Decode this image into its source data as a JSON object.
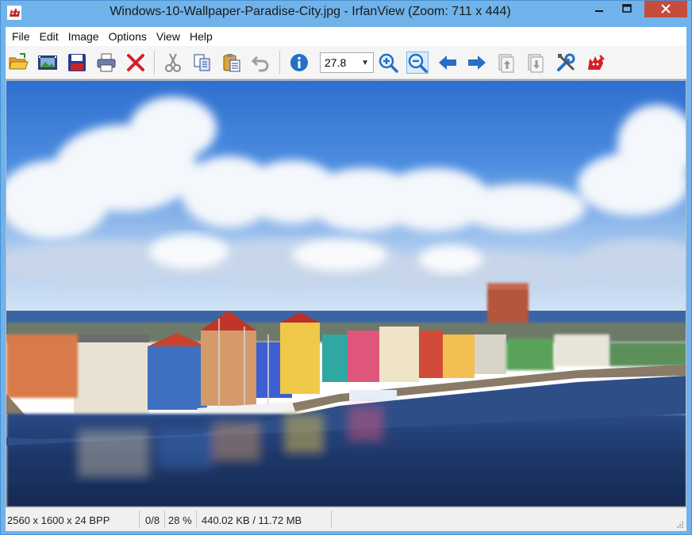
{
  "window": {
    "title": "Windows-10-Wallpaper-Paradise-City.jpg - IrfanView (Zoom: 711 x 444)",
    "app_icon": "irfanview-cat-icon",
    "controls": [
      "minimize-icon",
      "maximize-icon",
      "close-icon"
    ],
    "accent_color": "#6fb3ea",
    "close_color": "#c74c3c"
  },
  "menu": {
    "items": [
      "File",
      "Edit",
      "Image",
      "Options",
      "View",
      "Help"
    ]
  },
  "toolbar": {
    "buttons": [
      {
        "name": "open",
        "icon": "open-folder-icon"
      },
      {
        "name": "slideshow",
        "icon": "slideshow-icon"
      },
      {
        "name": "save",
        "icon": "save-disk-icon"
      },
      {
        "name": "print",
        "icon": "printer-icon"
      },
      {
        "name": "delete",
        "icon": "delete-x-icon"
      },
      {
        "name": "cut",
        "icon": "scissors-icon"
      },
      {
        "name": "copy",
        "icon": "copy-icon"
      },
      {
        "name": "paste",
        "icon": "paste-clipboard-icon"
      },
      {
        "name": "undo",
        "icon": "undo-arrow-icon"
      },
      {
        "name": "info",
        "icon": "info-icon"
      },
      {
        "name": "zoom-in",
        "icon": "zoom-in-icon"
      },
      {
        "name": "zoom-out",
        "icon": "zoom-out-icon"
      },
      {
        "name": "previous",
        "icon": "arrow-left-icon"
      },
      {
        "name": "next",
        "icon": "arrow-right-icon"
      },
      {
        "name": "first",
        "icon": "first-page-icon"
      },
      {
        "name": "last",
        "icon": "last-page-icon"
      },
      {
        "name": "properties",
        "icon": "tools-icon"
      },
      {
        "name": "exit",
        "icon": "irfanview-cat-icon"
      }
    ],
    "zoom_value": "27.8"
  },
  "image": {
    "description_icon": "city-waterfront-photo"
  },
  "status": {
    "dimensions": "2560 x 1600 x 24 BPP",
    "index": "0/8",
    "zoom_percent": "28 %",
    "file_size": "440.02 KB / 11.72 MB"
  }
}
